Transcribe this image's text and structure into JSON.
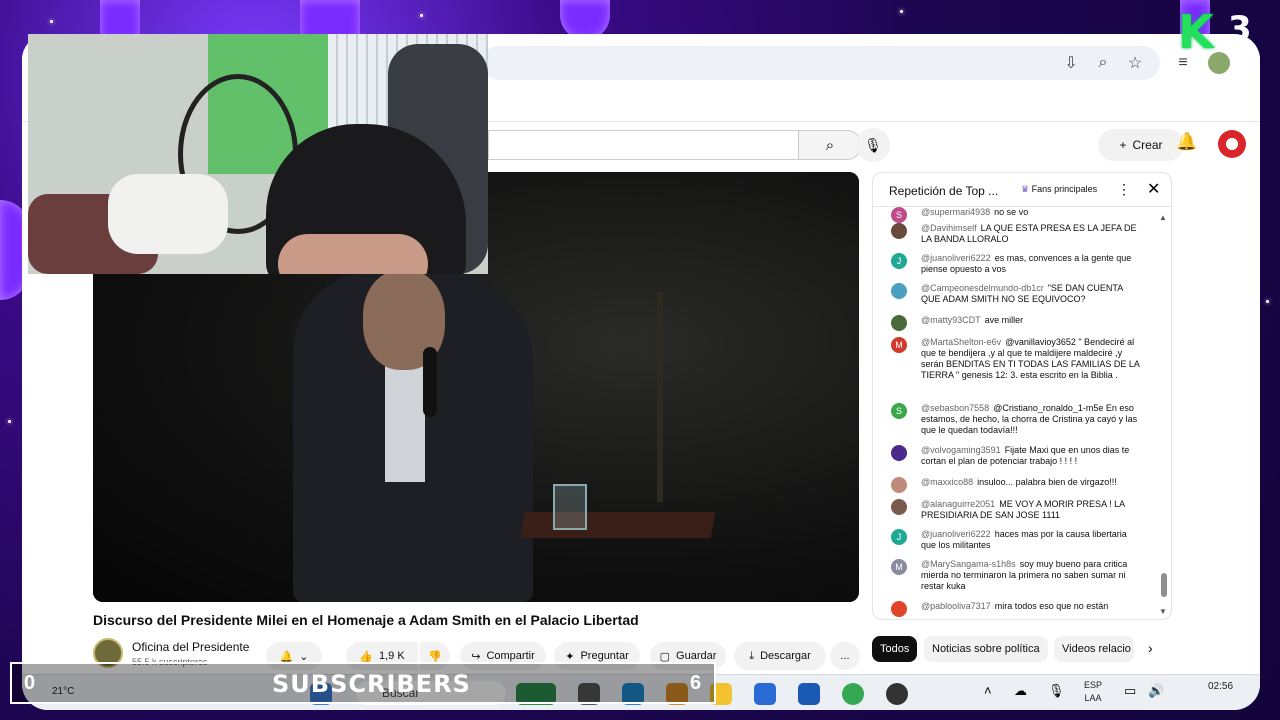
{
  "browser": {
    "icons": [
      "install-icon",
      "zoom-icon",
      "star-icon",
      "menu-icon",
      "profile-icon"
    ]
  },
  "youtube": {
    "create_label": "Crear",
    "video_title": "Discurso del Presidente Milei en el Homenaje a Adam Smith en el Palacio Libertad",
    "channel_name": "Oficina del Presidente",
    "channel_subs": "55.5 k suscriptores",
    "like_count": "1,9 K",
    "share_label": "Compartir",
    "ask_label": "Preguntar",
    "save_label": "Guardar",
    "download_label": "Descargar",
    "more_label": "..."
  },
  "chat": {
    "title": "Repetición de Top ...",
    "fans_label": "Fans principales",
    "messages": [
      {
        "author": "@supermari4938",
        "text": "no se vo",
        "color": "#c04a8a",
        "initial": "S"
      },
      {
        "author": "@Davihimself",
        "text": "LA QUE ESTA PRESA ES LA JEFA DE LA BANDA LLORALO",
        "color": "#6a4a3a",
        "initial": ""
      },
      {
        "author": "@juanoliveri6222",
        "text": "es mas, convences a la gente que piense opuesto a vos",
        "color": "#1fa894",
        "initial": "J"
      },
      {
        "author": "@Campeonesdelmundo-db1cr",
        "text": "\"SE DAN CUENTA QUE ADAM SMITH NO SE EQUIVOCO?",
        "color": "#4aa0c0",
        "initial": ""
      },
      {
        "author": "@matty93CDT",
        "text": "ave miller",
        "color": "#4a6a3a",
        "initial": ""
      },
      {
        "author": "@MartaShelton-e6v",
        "text": "@vanillavioy3652 \" Bendeciré al que te bendijera ,y al que te maldijere maldeciré ,y serán BENDITAS EN TI TODAS LAS FAMILIAS DE LA TIERRA \" genesis 12: 3. esta escrito en la Biblia .",
        "color": "#d0392b",
        "initial": "M"
      },
      {
        "author": "@sebasbon7558",
        "text": "@Cristiano_ronaldo_1-m5e En eso estamos, de hecho, la chorra de Cristina ya cayó y las que le quedan todavía!!!",
        "color": "#3aa84a",
        "initial": "S"
      },
      {
        "author": "@volvogaming3591",
        "text": "Fijate Maxi que en unos dias te cortan el plan de potenciar trabajo ! ! ! !",
        "color": "#4a2a8a",
        "initial": ""
      },
      {
        "author": "@maxxico88",
        "text": "insuloo... palabra bien de virgazo!!!",
        "color": "#c08a7a",
        "initial": ""
      },
      {
        "author": "@alanaguirre2051",
        "text": "ME VOY A MORIR PRESA ! LA PRESIDIARIA DE SAN JOSE 1111",
        "color": "#7a5a4a",
        "initial": ""
      },
      {
        "author": "@juanoliveri6222",
        "text": "haces mas por la causa libertaria que los militantes",
        "color": "#1fa894",
        "initial": "J"
      },
      {
        "author": "@MarySangama-s1h8s",
        "text": "soy muy bueno para critica mierda no terminaron la primera no saben sumar ni restar kuka",
        "color": "#8a8aa0",
        "initial": "M"
      },
      {
        "author": "@pablooliva7317",
        "text": "mira todos eso que no están",
        "color": "#e0452a",
        "initial": ""
      }
    ]
  },
  "chips": {
    "all": "Todos",
    "politics": "Noticias sobre política",
    "related": "Videos relacio"
  },
  "taskbar": {
    "temp": "21°C",
    "search_placeholder": "Buscar",
    "lang_top": "ESP",
    "lang_bottom": "LAA",
    "clock": "02:56"
  },
  "overlay": {
    "k_logo": "K",
    "k_number": "3",
    "subscribers_label": "SUBSCRIBERS",
    "subscribers_count": "0",
    "subscribers_goal": "6"
  },
  "colors": {
    "frame_purple": "#7a2cff",
    "yt_red": "#d9262d",
    "k_green": "#22e05a"
  }
}
